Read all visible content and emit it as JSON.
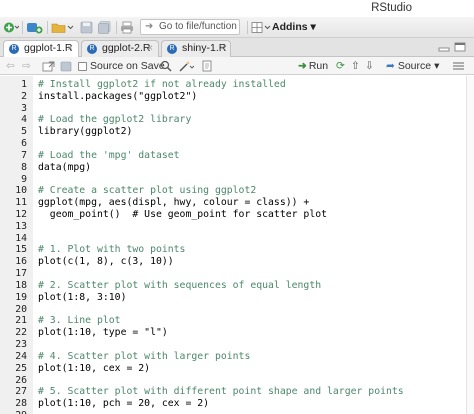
{
  "window": {
    "title": "RStudio"
  },
  "toolbar": {
    "goto_placeholder": "Go to file/function",
    "addins_label": "Addins"
  },
  "tabs": [
    {
      "label": "ggplot-1.R",
      "active": true
    },
    {
      "label": "ggplot-2.R",
      "active": false
    },
    {
      "label": "shiny-1.R",
      "active": false
    }
  ],
  "editor_toolbar": {
    "source_on_save_label": "Source on Save",
    "run_label": "Run",
    "source_label": "Source"
  },
  "code_lines": [
    {
      "n": "1",
      "text": "# Install ggplot2 if not already installed",
      "type": "comment"
    },
    {
      "n": "2",
      "text": "install.packages(\"ggplot2\")",
      "type": "code"
    },
    {
      "n": "3",
      "text": "",
      "type": "code"
    },
    {
      "n": "4",
      "text": "# Load the ggplot2 library",
      "type": "comment"
    },
    {
      "n": "5",
      "text": "library(ggplot2)",
      "type": "code"
    },
    {
      "n": "6",
      "text": "",
      "type": "code"
    },
    {
      "n": "7",
      "text": "# Load the 'mpg' dataset",
      "type": "comment"
    },
    {
      "n": "8",
      "text": "data(mpg)",
      "type": "code"
    },
    {
      "n": "9",
      "text": "",
      "type": "code"
    },
    {
      "n": "10",
      "text": "# Create a scatter plot using ggplot2",
      "type": "comment"
    },
    {
      "n": "11",
      "text": "ggplot(mpg, aes(displ, hwy, colour = class)) +",
      "type": "code"
    },
    {
      "n": "12",
      "text": "  geom_point()  # Use geom_point for scatter plot",
      "type": "code"
    },
    {
      "n": "13",
      "text": "",
      "type": "code"
    },
    {
      "n": "14",
      "text": "",
      "type": "code"
    },
    {
      "n": "15",
      "text": "# 1. Plot with two points",
      "type": "comment"
    },
    {
      "n": "16",
      "text": "plot(c(1, 8), c(3, 10))",
      "type": "code"
    },
    {
      "n": "17",
      "text": "",
      "type": "code"
    },
    {
      "n": "18",
      "text": "# 2. Scatter plot with sequences of equal length",
      "type": "comment"
    },
    {
      "n": "19",
      "text": "plot(1:8, 3:10)",
      "type": "code"
    },
    {
      "n": "20",
      "text": "",
      "type": "code"
    },
    {
      "n": "21",
      "text": "# 3. Line plot",
      "type": "comment"
    },
    {
      "n": "22",
      "text": "plot(1:10, type = \"l\")",
      "type": "code"
    },
    {
      "n": "23",
      "text": "",
      "type": "code"
    },
    {
      "n": "24",
      "text": "# 4. Scatter plot with larger points",
      "type": "comment"
    },
    {
      "n": "25",
      "text": "plot(1:10, cex = 2)",
      "type": "code"
    },
    {
      "n": "26",
      "text": "",
      "type": "code"
    },
    {
      "n": "27",
      "text": "# 5. Scatter plot with different point shape and larger points",
      "type": "comment"
    },
    {
      "n": "28",
      "text": "plot(1:10, pch = 20, cex = 2)",
      "type": "code"
    },
    {
      "n": "29",
      "text": "",
      "type": "code"
    }
  ],
  "colors": {
    "comment": "#4c886b",
    "file_icon": "#2a6ab6"
  }
}
